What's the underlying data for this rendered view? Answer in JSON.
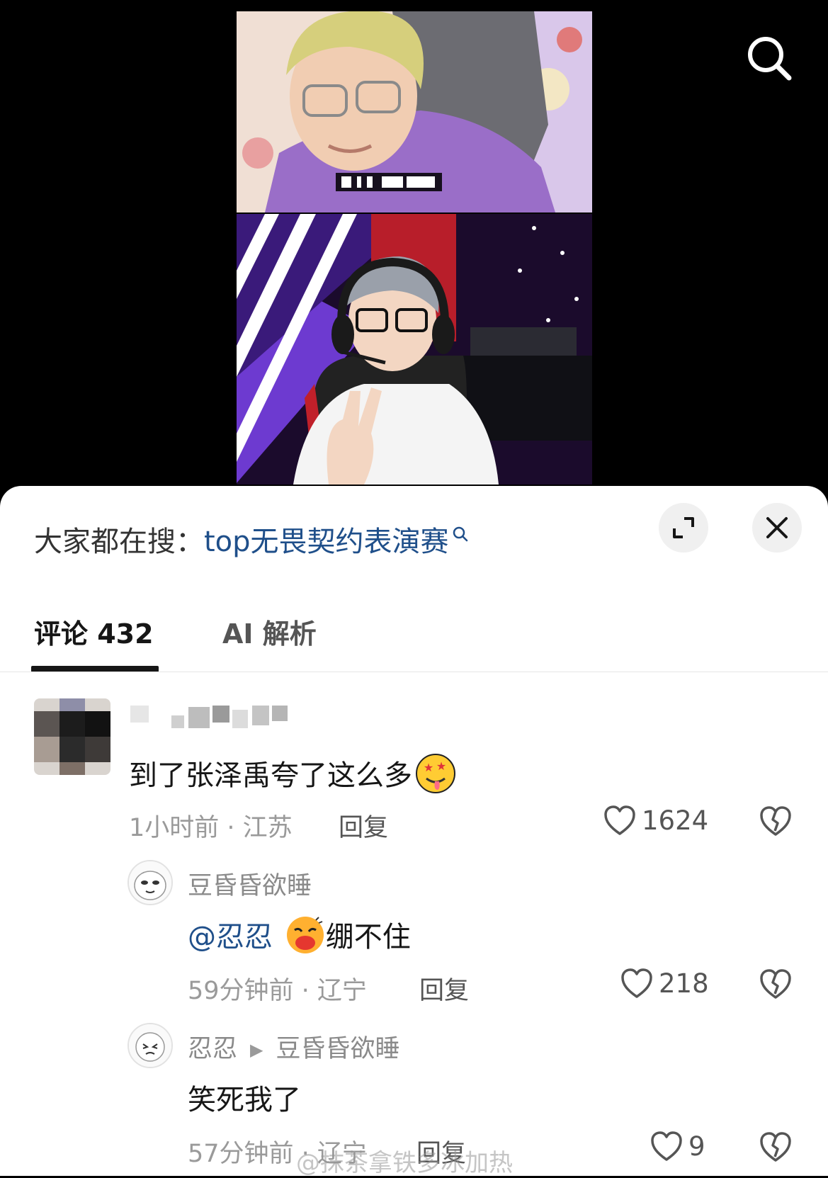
{
  "trending": {
    "prefix": "大家都在搜：",
    "query": "top无畏契约表演赛"
  },
  "tabs": {
    "comments": "评论 432",
    "ai": "AI 解析"
  },
  "comments": [
    {
      "text": "到了张泽禹夸了这么多",
      "emoji": "drooling-star-eyes-emoji",
      "time_location": "1小时前 · 江苏",
      "reply_label": "回复",
      "likes": "1624"
    }
  ],
  "replies": [
    {
      "username": "豆昏昏欲睡",
      "mention": "@忍忍",
      "text_after": "绷不住",
      "emoji": "kiss-emoji",
      "time_location": "59分钟前 · 辽宁",
      "reply_label": "回复",
      "likes": "218"
    },
    {
      "username": "忍忍",
      "reply_to": "豆昏昏欲睡",
      "text": "笑死我了",
      "time_location": "57分钟前 · 辽宁",
      "reply_label": "回复",
      "likes": "9"
    }
  ],
  "watermark": "@抹茶拿铁多冰加热",
  "icons": {
    "search": "search-icon",
    "expand": "expand-icon",
    "close": "close-icon",
    "like": "heart-icon",
    "dislike": "broken-heart-icon"
  },
  "colors": {
    "link_blue": "#1f4f8a",
    "text_primary": "#161616",
    "text_secondary": "#9a9a9a"
  }
}
